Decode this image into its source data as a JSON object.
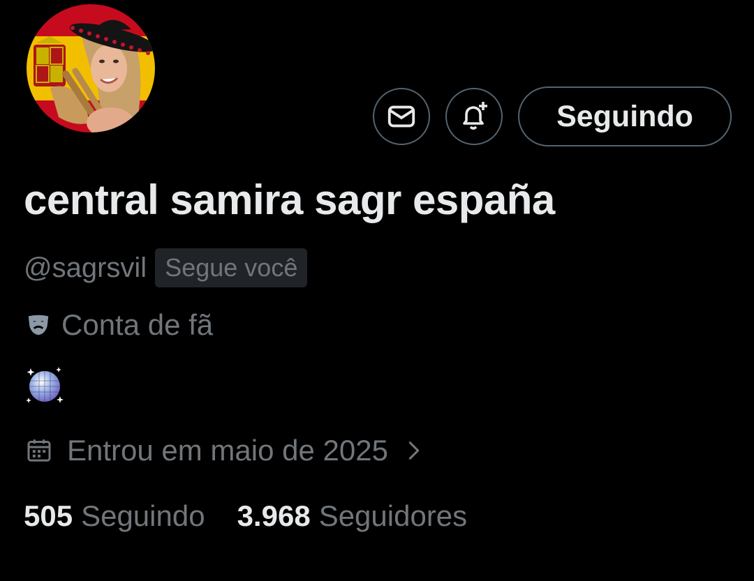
{
  "profile": {
    "display_name": "central samira sagr españa",
    "handle": "@sagrsvil",
    "follows_you_badge": "Segue você",
    "label": "Conta de fã",
    "joined": "Entrou em maio de 2025",
    "following_count": "505",
    "following_label": "Seguindo",
    "followers_count": "3.968",
    "followers_label": "Seguidores"
  },
  "actions": {
    "message_icon": "envelope-icon",
    "notify_icon": "bell-plus-icon",
    "follow_button_label": "Seguindo"
  },
  "icons": {
    "label_icon": "theater-masks-icon",
    "bio_emoji": "disco-ball-icon",
    "calendar_icon": "calendar-icon",
    "chevron": "chevron-right-icon"
  },
  "colors": {
    "background": "#000000",
    "primary_text": "#e7e9ea",
    "secondary_text": "#71767b",
    "border": "#536471",
    "badge_bg": "#202327"
  }
}
